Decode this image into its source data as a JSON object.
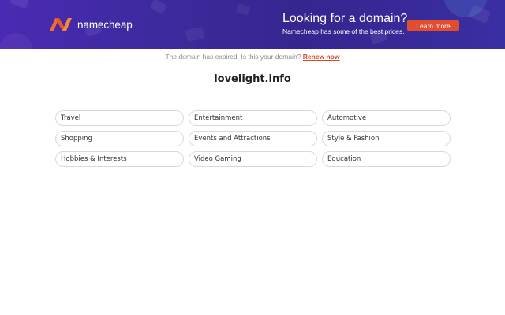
{
  "banner": {
    "logo_text": "namecheap",
    "promo_title": "Looking for a domain?",
    "promo_subtitle": "Namecheap has some of the best prices.",
    "cta_label": "Learn more",
    "colors": {
      "background": "#3c2a9c",
      "accent": "#e04d2f",
      "logo_orange": "#f26b2e"
    }
  },
  "notice": {
    "text": "The domain has expired. Is this your domain?",
    "link_label": "Renew now"
  },
  "domain": "lovelight.info",
  "categories": [
    "Travel",
    "Entertainment",
    "Automotive",
    "Shopping",
    "Events and Attractions",
    "Style & Fashion",
    "Hobbies & Interests",
    "Video Gaming",
    "Education"
  ]
}
